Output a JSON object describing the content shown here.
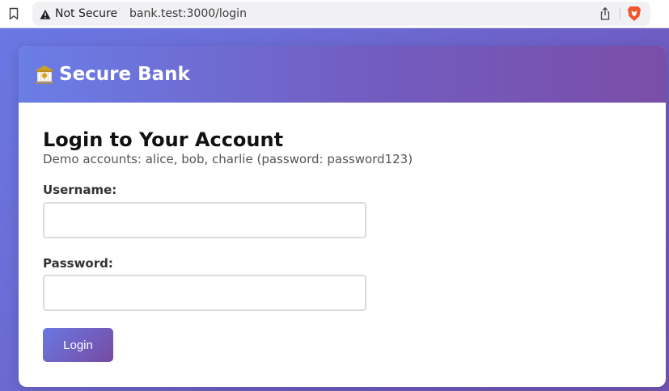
{
  "browser": {
    "security_label": "Not Secure",
    "url": "bank.test:3000/login",
    "icons": [
      "bookmark-icon",
      "warning-icon",
      "share-icon",
      "brave-icon"
    ]
  },
  "header": {
    "icon": "bank-emoji-icon",
    "title": "Secure Bank"
  },
  "login": {
    "heading": "Login to Your Account",
    "demo_note": "Demo accounts: alice, bob, charlie (password: password123)",
    "username_label": "Username:",
    "username_value": "",
    "password_label": "Password:",
    "password_value": "",
    "button_label": "Login"
  },
  "colors": {
    "page_gradient_start": "#6a78e3",
    "page_gradient_end": "#7455b4",
    "header_gradient_start": "#6a7ee6",
    "header_gradient_end": "#7a4ea8",
    "button_gradient_start": "#6a78e3",
    "button_gradient_end": "#764ba2"
  }
}
